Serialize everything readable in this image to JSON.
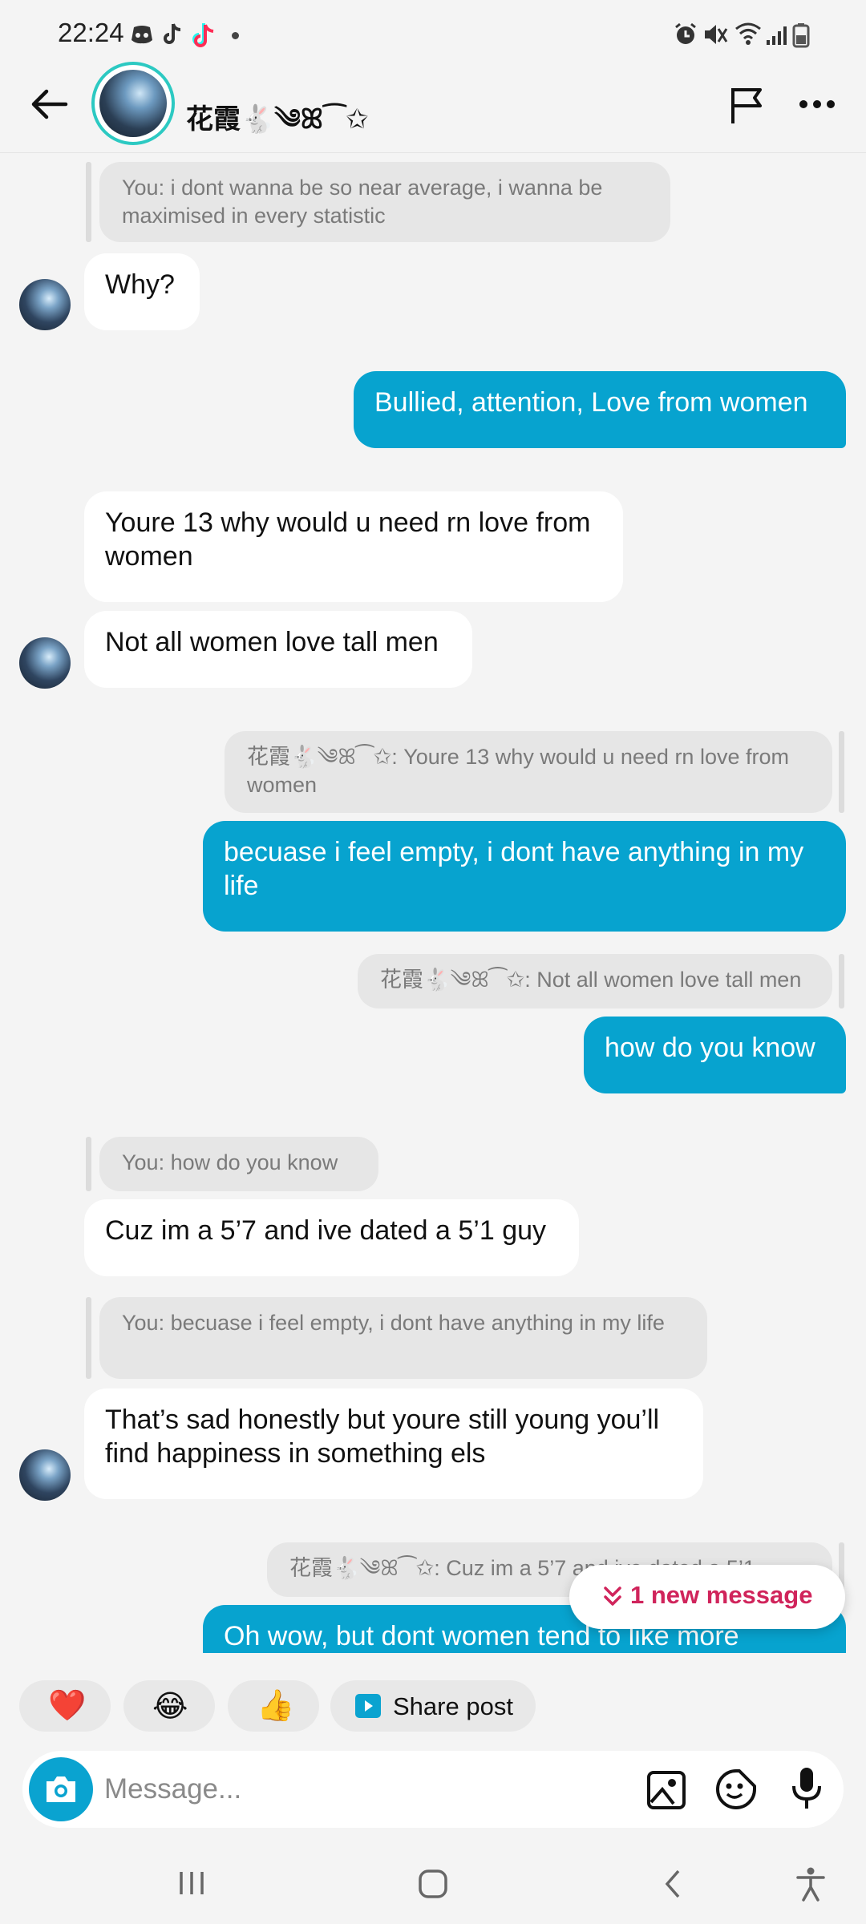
{
  "status_bar": {
    "time": "22:24"
  },
  "header": {
    "contact_name": "花霞🐇༄ꕤ⁀✩"
  },
  "messages": [
    {
      "quote": "You: i dont wanna be so near average, i wanna be maximised in every statistic"
    },
    {
      "text": "Why?"
    },
    {
      "text": "Bullied, attention, Love from women"
    },
    {
      "text": "Youre 13 why would u need rn love from women"
    },
    {
      "text": "Not all women love tall men"
    },
    {
      "quote": "花霞🐇༄ꕤ⁀✩: Youre 13 why would u need rn love from women"
    },
    {
      "text": "becuase i feel empty, i dont have anything in my life"
    },
    {
      "quote": "花霞🐇༄ꕤ⁀✩: Not all women love tall men"
    },
    {
      "text": "how do you know"
    },
    {
      "quote": "You: how do you know"
    },
    {
      "text": "Cuz im a 5’7 and ive dated a 5’1 guy"
    },
    {
      "quote": "You: becuase i feel empty, i dont have anything in my life"
    },
    {
      "text": "That’s sad honestly but youre still young you’ll find happiness in something els"
    },
    {
      "quote": "花霞🐇༄ꕤ⁀✩: Cuz im a 5’7 and ive dated a 5’1"
    },
    {
      "text": "Oh wow, but dont women tend to like more"
    }
  ],
  "new_message_pill": "1 new message",
  "quick_reactions": [
    "❤️",
    "😂",
    "👍"
  ],
  "share_post_label": "Share post",
  "composer": {
    "placeholder": "Message..."
  }
}
